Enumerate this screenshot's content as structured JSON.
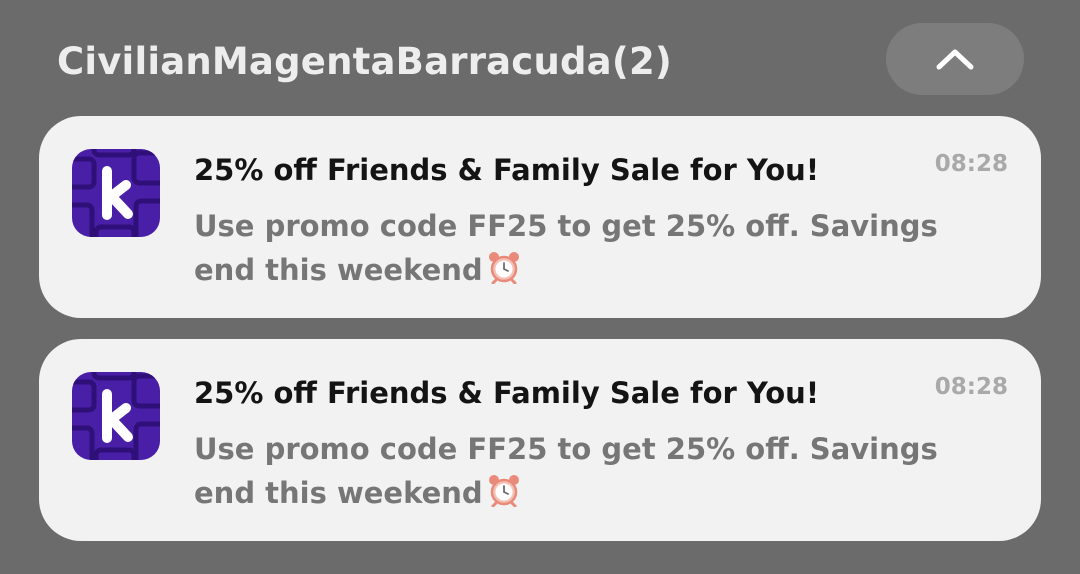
{
  "group": {
    "title": "CivilianMagentaBarracuda(2)",
    "collapse_icon": "chevron-up-icon"
  },
  "colors": {
    "background": "#6b6b6b",
    "card": "#f2f2f2",
    "app_icon": "#4a1fa8"
  },
  "notifications": [
    {
      "app_icon": "k-app-icon",
      "title": "25% off Friends & Family Sale for You!",
      "time": "08:28",
      "body": "Use promo code FF25 to get 25% off. Savings end this weekend",
      "body_emoji": "alarm-clock-icon"
    },
    {
      "app_icon": "k-app-icon",
      "title": "25% off Friends & Family Sale for You!",
      "time": "08:28",
      "body": "Use promo code FF25 to get 25% off. Savings end this weekend",
      "body_emoji": "alarm-clock-icon"
    }
  ]
}
